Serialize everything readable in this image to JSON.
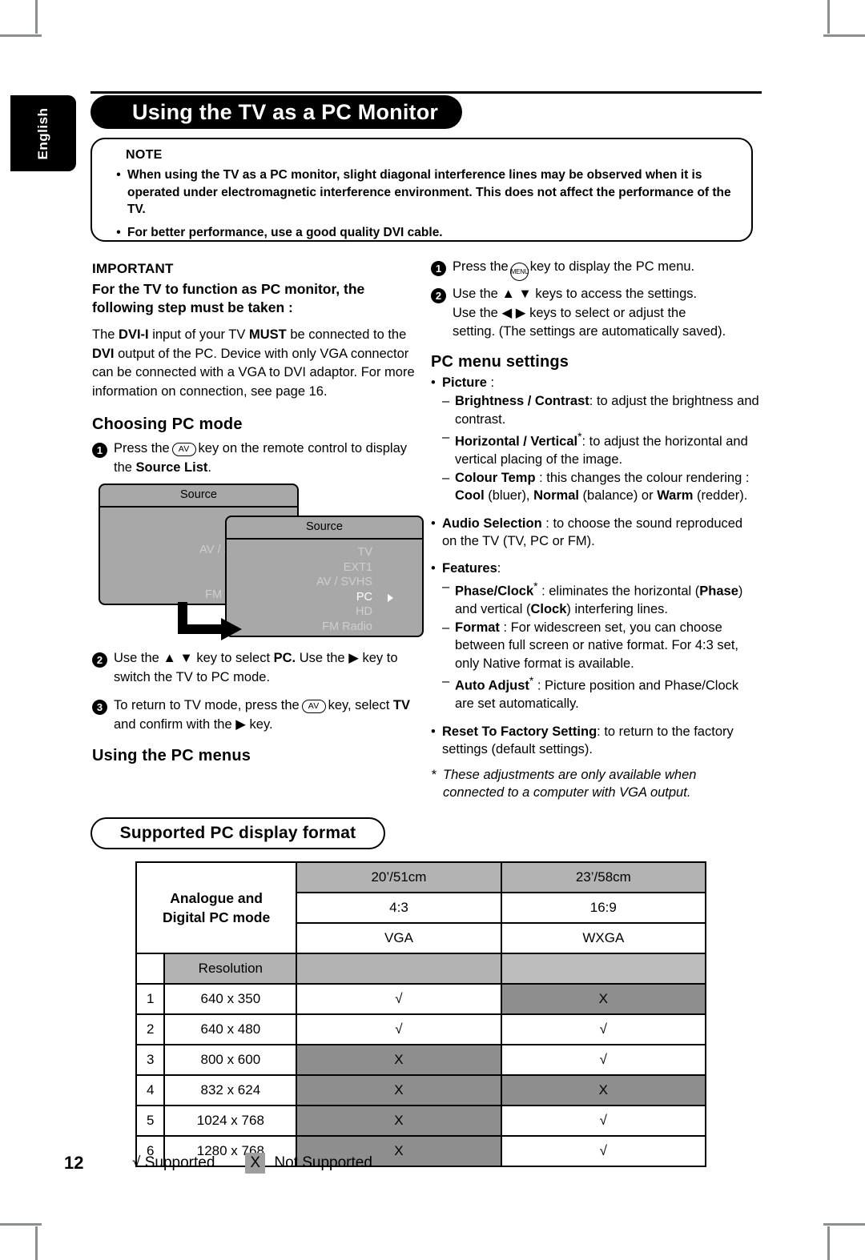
{
  "language_tab": "English",
  "header": {
    "title": "Using the TV as a PC Monitor"
  },
  "note": {
    "title": "NOTE",
    "bullet_glyph": "•",
    "items": [
      "When using the TV as a PC monitor, slight diagonal interference lines may be observed when it is operated under electromagnetic interference environment. This does not affect the performance of the TV.",
      "For better performance, use a good quality DVI cable."
    ]
  },
  "important": {
    "heading": "IMPORTANT",
    "subheading": "For the TV to function as PC monitor, the following step must be taken :",
    "body_1": "The ",
    "body_b1": "DVI-I",
    "body_2": " input of your TV ",
    "body_b2": "MUST",
    "body_3": " be connected to the ",
    "body_b3": "DVI",
    "body_4": " output of the PC. Device with only VGA connector can be connected with a VGA to DVI adaptor. For more information on connection, see page 16."
  },
  "choosing_pc_mode": {
    "heading": "Choosing PC mode",
    "step1_a": "Press the",
    "step1_key": "AV",
    "step1_b": "key on the remote control to display the ",
    "step1_bold": "Source List",
    "step1_c": ".",
    "step2_a": "Use the",
    "step2_b": "key to select ",
    "step2_bold": "PC.",
    "step2_c": " Use the",
    "step2_d": "key to switch the TV to PC mode.",
    "step3_a": "To return to TV mode, press the",
    "step3_key": "AV",
    "step3_b": "key, select ",
    "step3_bold": "TV",
    "step3_c": " and confirm with the",
    "step3_d": "key.",
    "numbers": [
      "1",
      "2",
      "3"
    ]
  },
  "source_menu_1": {
    "caption": "Source",
    "items": [
      "TV",
      "EXT1",
      "AV / SVHS",
      "PC",
      "HD",
      "FM Radio"
    ],
    "selected": "TV"
  },
  "source_menu_2": {
    "caption": "Source",
    "items": [
      "TV",
      "EXT1",
      "AV / SVHS",
      "PC",
      "HD",
      "FM Radio"
    ],
    "selected": "PC"
  },
  "using_pc_menus": {
    "heading": "Using the PC menus"
  },
  "pc_menu_steps": {
    "numbers": [
      "1",
      "2"
    ],
    "step1_a": "Press the",
    "step1_key": "MENU",
    "step1_b": "key to display the PC menu.",
    "step2_l1_a": "Use the",
    "step2_l1_b": "keys to access the settings.",
    "step2_l2_a": "Use the",
    "step2_l2_b": "keys to select or adjust the",
    "step2_l3": "setting. (The settings are automatically saved)."
  },
  "pc_menu_settings": {
    "heading": "PC menu settings",
    "bullet_glyph": "•",
    "dash_glyph": "–",
    "picture": {
      "label": "Picture",
      "label_suffix": " :",
      "sub": [
        {
          "bold": "Brightness / Contrast",
          "rest": ": to adjust the brightness and contrast."
        },
        {
          "bold": "Horizontal / Vertical",
          "star": "*",
          "rest": ": to adjust the horizontal and vertical placing of the image."
        },
        {
          "bold": "Colour Temp",
          "rest": " : this changes the colour rendering : ",
          "b2": "Cool",
          "rest2": " (bluer), ",
          "b3": "Normal",
          "rest3": " (balance) or ",
          "b4": "Warm",
          "rest4": " (redder)."
        }
      ]
    },
    "audio_selection": {
      "bold": "Audio Selection",
      "rest": " : to choose the sound reproduced on the TV (TV, PC or FM)."
    },
    "features": {
      "label": "Features",
      "label_suffix": ":",
      "sub": [
        {
          "bold": "Phase/Clock",
          "star": "*",
          "rest": " : eliminates the horizontal (",
          "b2": "Phase",
          "rest2": ") and vertical (",
          "b3": "Clock",
          "rest3": ") interfering lines."
        },
        {
          "bold": "Format",
          "rest": " : For widescreen set, you can choose between full screen or native format. For 4:3 set, only Native format is available."
        },
        {
          "bold": "Auto Adjust",
          "star": "*",
          "rest": " : Picture position and Phase/Clock are set automatically."
        }
      ]
    },
    "reset": {
      "bold": "Reset To Factory Setting",
      "rest": ": to return to the factory settings (default settings)."
    },
    "footnote_star": "*",
    "footnote": "These adjustments are only available when connected to a computer with VGA output."
  },
  "supported_format": {
    "pill_title": "Supported PC display format",
    "table": {
      "row_label": "Analogue and\nDigital PC mode",
      "row_label_l1": "Analogue and",
      "row_label_l2": "Digital PC mode",
      "size_headers": [
        "20’/51cm",
        "23’/58cm"
      ],
      "ratio_row": [
        "4:3",
        "16:9"
      ],
      "mode_row": [
        "VGA",
        "WXGA"
      ],
      "resolution_header": "Resolution",
      "rows": [
        {
          "idx": "1",
          "resolution": "640 x 350",
          "col1": "√",
          "col2": "X"
        },
        {
          "idx": "2",
          "resolution": "640 x 480",
          "col1": "√",
          "col2": "√"
        },
        {
          "idx": "3",
          "resolution": "800 x 600",
          "col1": "X",
          "col2": "√"
        },
        {
          "idx": "4",
          "resolution": "832 x 624",
          "col1": "X",
          "col2": "X"
        },
        {
          "idx": "5",
          "resolution": "1024 x 768",
          "col1": "X",
          "col2": "√"
        },
        {
          "idx": "6",
          "resolution": "1280 x 768",
          "col1": "X",
          "col2": "√"
        }
      ]
    }
  },
  "footer": {
    "page_number": "12",
    "legend_tick": "√",
    "legend_tick_label": "Supported",
    "legend_x": "X",
    "legend_x_label": "Not Supported"
  },
  "colors": {
    "menu_gray": "#a8a8a8",
    "table_header_gray": "#b3b3b3",
    "table_cell_dark": "#8e8e8e",
    "black": "#000000"
  }
}
